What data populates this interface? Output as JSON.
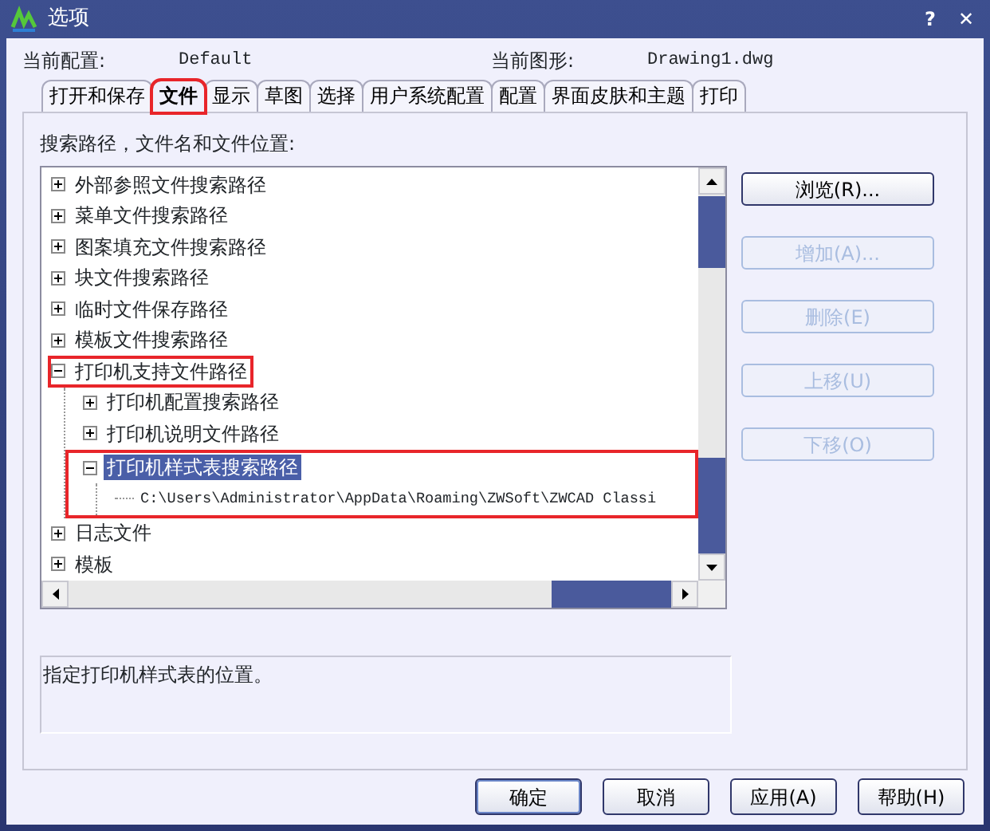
{
  "window": {
    "title": "选项",
    "help_button": "?",
    "close_button": "✕"
  },
  "profile": {
    "label": "当前配置:",
    "value": "Default"
  },
  "drawing": {
    "label": "当前图形:",
    "value": "Drawing1.dwg"
  },
  "tabs": [
    {
      "label": "打开和保存",
      "selected": false,
      "highlighted": false
    },
    {
      "label": "文件",
      "selected": true,
      "highlighted": true
    },
    {
      "label": "显示",
      "selected": false,
      "highlighted": false
    },
    {
      "label": "草图",
      "selected": false,
      "highlighted": false
    },
    {
      "label": "选择",
      "selected": false,
      "highlighted": false
    },
    {
      "label": "用户系统配置",
      "selected": false,
      "highlighted": false
    },
    {
      "label": "配置",
      "selected": false,
      "highlighted": false
    },
    {
      "label": "界面皮肤和主题",
      "selected": false,
      "highlighted": false
    },
    {
      "label": "打印",
      "selected": false,
      "highlighted": false
    }
  ],
  "tree_label": "搜索路径，文件名和文件位置:",
  "tree": [
    {
      "label": "外部参照文件搜索路径",
      "expanded": false,
      "selected": false
    },
    {
      "label": "菜单文件搜索路径",
      "expanded": false,
      "selected": false
    },
    {
      "label": "图案填充文件搜索路径",
      "expanded": false,
      "selected": false
    },
    {
      "label": "块文件搜索路径",
      "expanded": false,
      "selected": false
    },
    {
      "label": "临时文件保存路径",
      "expanded": false,
      "selected": false
    },
    {
      "label": "模板文件搜索路径",
      "expanded": false,
      "selected": false
    },
    {
      "label": "打印机支持文件路径",
      "expanded": true,
      "selected": false,
      "highlighted": true,
      "highlight_includes_children": false,
      "children": [
        {
          "label": "打印机配置搜索路径",
          "expanded": false,
          "selected": false
        },
        {
          "label": "打印机说明文件路径",
          "expanded": false,
          "selected": false
        },
        {
          "label": "打印机样式表搜索路径",
          "expanded": true,
          "selected": true,
          "highlighted": true,
          "highlight_includes_children": true,
          "children": [
            {
              "label": "C:\\Users\\Administrator\\AppData\\Roaming\\ZWSoft\\ZWCAD Classi",
              "kind": "path",
              "selected": false
            }
          ]
        }
      ]
    },
    {
      "label": "日志文件",
      "expanded": false,
      "selected": false
    },
    {
      "label": "模板",
      "expanded": false,
      "selected": false
    }
  ],
  "side_buttons": [
    {
      "label": "浏览(R)...",
      "disabled": false
    },
    {
      "label": "增加(A)...",
      "disabled": true
    },
    {
      "label": "删除(E)",
      "disabled": true
    },
    {
      "label": "上移(U)",
      "disabled": true
    },
    {
      "label": "下移(O)",
      "disabled": true
    }
  ],
  "description": "指定打印机样式表的位置。",
  "footer_buttons": [
    {
      "label": "确定",
      "default": true
    },
    {
      "label": "取消",
      "default": false
    },
    {
      "label": "应用(A)",
      "default": false
    },
    {
      "label": "帮助(H)",
      "default": false
    }
  ]
}
